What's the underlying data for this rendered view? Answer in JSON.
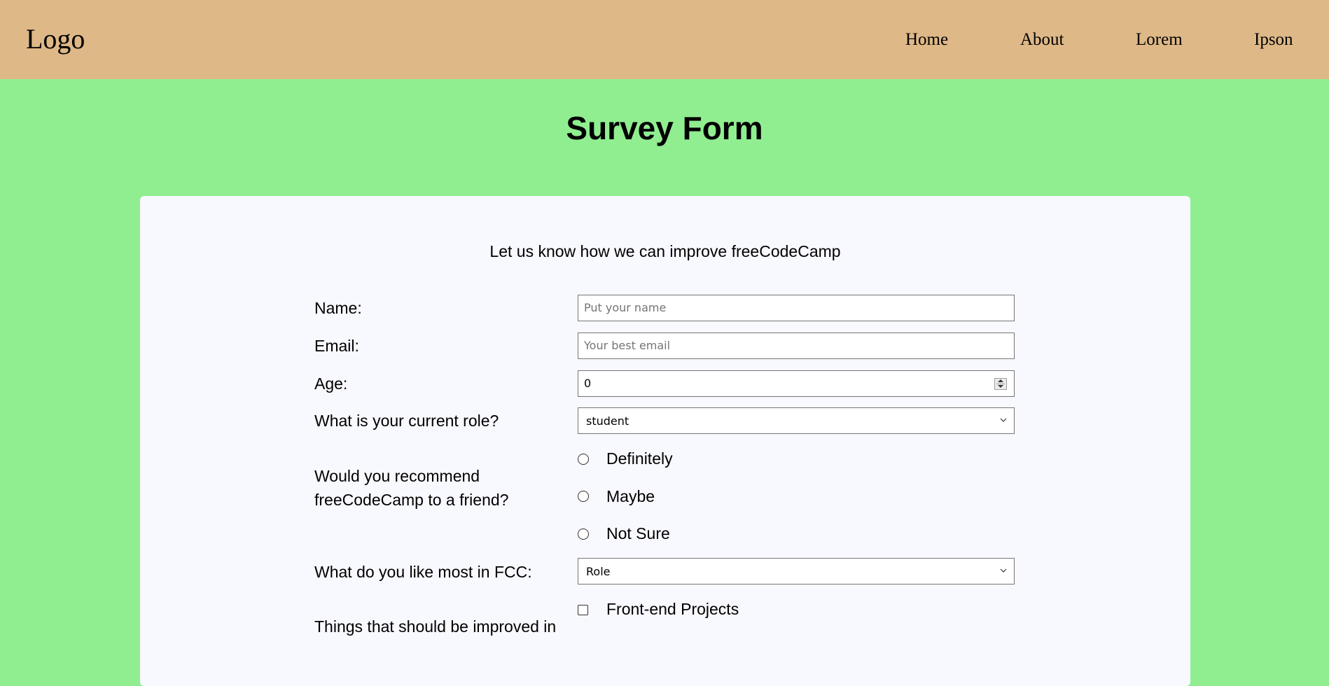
{
  "header": {
    "logo": "Logo",
    "nav": [
      "Home",
      "About",
      "Lorem",
      "Ipson"
    ]
  },
  "page": {
    "title": "Survey Form"
  },
  "form": {
    "description": "Let us know how we can improve freeCodeCamp",
    "name": {
      "label": "Name:",
      "placeholder": "Put your name"
    },
    "email": {
      "label": "Email:",
      "placeholder": "Your best email"
    },
    "age": {
      "label": "Age:",
      "value": "0"
    },
    "role": {
      "label": "What is your current role?",
      "selected": "student"
    },
    "recommend": {
      "label_line1": "Would you recommend",
      "label_line2": "freeCodeCamp to a friend?",
      "options": [
        "Definitely",
        "Maybe",
        "Not Sure"
      ]
    },
    "like_most": {
      "label": "What do you like most in FCC:",
      "selected": "Role"
    },
    "improve": {
      "label_line1": "Things that should be improved in",
      "options": [
        "Front-end Projects"
      ]
    }
  },
  "colors": {
    "header_bg": "#deb887",
    "page_bg": "#90ee90",
    "card_bg": "#f8f8ff"
  }
}
